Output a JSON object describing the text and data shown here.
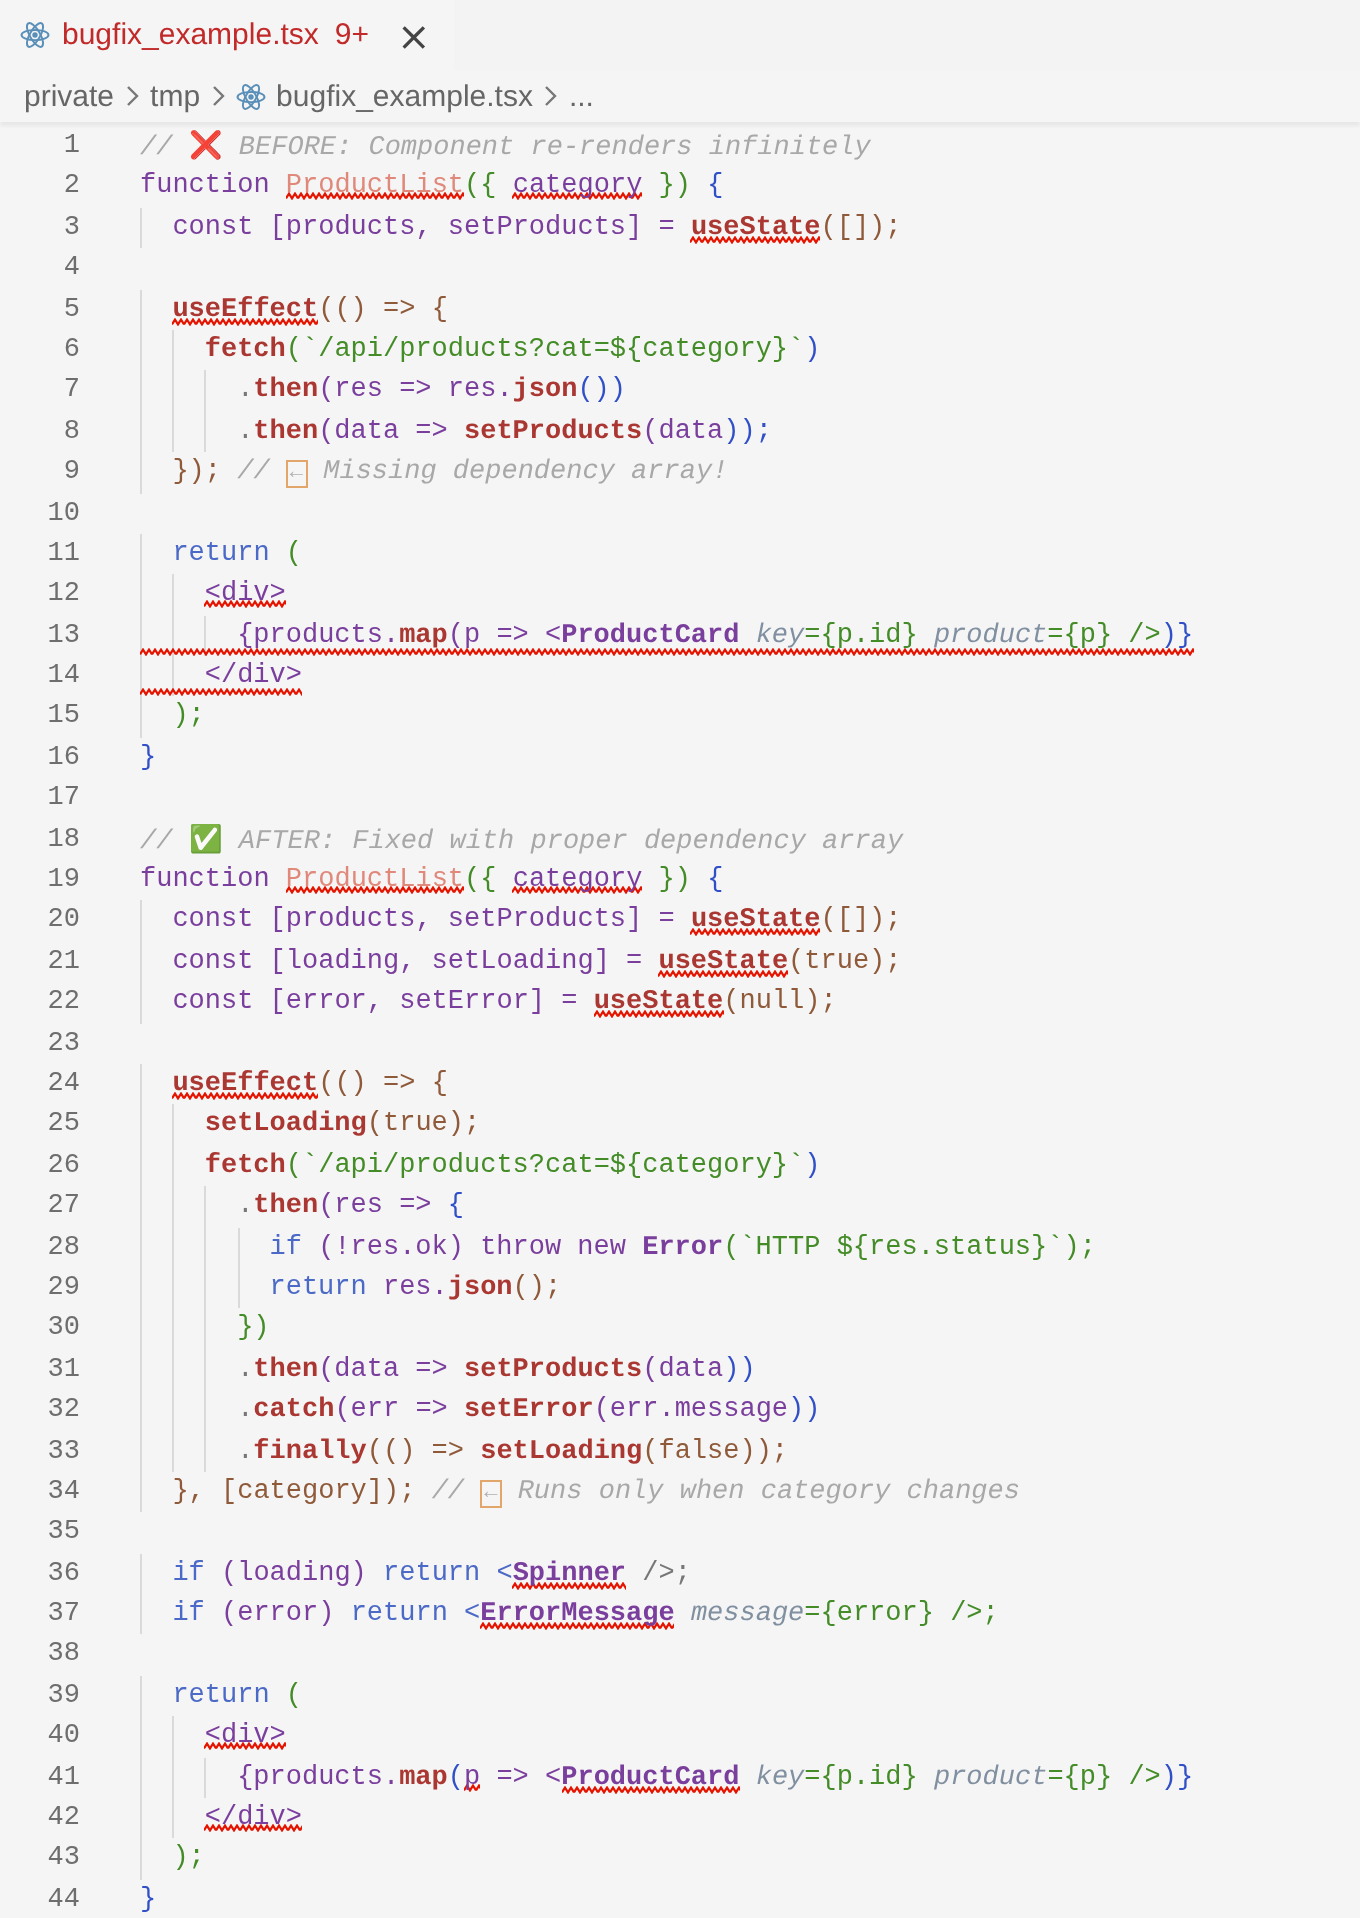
{
  "tab": {
    "title": "bugfix_example.tsx",
    "problems": "9+",
    "close": "×"
  },
  "breadcrumbs": [
    {
      "label": "private",
      "kind": "folder"
    },
    {
      "label": "tmp",
      "kind": "folder"
    },
    {
      "label": "bugfix_example.tsx",
      "kind": "file"
    },
    {
      "label": "...",
      "kind": "more"
    }
  ],
  "lines": [
    {
      "number": "1",
      "squiggly": false,
      "tokens": [
        {
          "kind": "cmt",
          "text": "// ",
          "squiggly": false
        },
        {
          "kind": "emoji",
          "text": "❌",
          "squiggly": false
        },
        {
          "kind": "cmt",
          "text": " BEFORE: Component re-renders infinitely",
          "squiggly": false
        }
      ]
    },
    {
      "number": "2",
      "squiggly": false,
      "tokens": [
        {
          "kind": "kw",
          "text": "function ",
          "squiggly": false
        },
        {
          "kind": "decl",
          "text": "ProductList",
          "squiggly": true
        },
        {
          "kind": "b2",
          "text": "({ ",
          "squiggly": false
        },
        {
          "kind": "var",
          "text": "category",
          "squiggly": true
        },
        {
          "kind": "b2",
          "text": " }) ",
          "squiggly": false
        },
        {
          "kind": "b3",
          "text": "{",
          "squiggly": false
        }
      ]
    },
    {
      "number": "3",
      "squiggly": false,
      "tokens": [
        {
          "kind": "kw",
          "text": "  const ",
          "squiggly": false
        },
        {
          "kind": "var",
          "text": "[products, setProducts] = ",
          "squiggly": false
        },
        {
          "kind": "call",
          "text": "useState",
          "squiggly": true
        },
        {
          "kind": "b1",
          "text": "([]);",
          "squiggly": false
        }
      ]
    },
    {
      "number": "4"
    },
    {
      "number": "5",
      "squiggly": false,
      "tokens": [
        {
          "kind": "call",
          "text": "  useEffect",
          "squiggly": true
        },
        {
          "kind": "b1",
          "text": "(() => {",
          "squiggly": false
        }
      ]
    },
    {
      "number": "6",
      "squiggly": false,
      "tokens": [
        {
          "kind": "call",
          "text": "    fetch",
          "squiggly": false
        },
        {
          "kind": "str",
          "text": "(`/api/products?cat=${category}`",
          "squiggly": false
        },
        {
          "kind": "b3",
          "text": ")",
          "squiggly": false
        }
      ]
    },
    {
      "number": "7",
      "squiggly": false,
      "tokens": [
        {
          "kind": "pn",
          "text": "      .",
          "squiggly": false
        },
        {
          "kind": "call",
          "text": "then",
          "squiggly": false
        },
        {
          "kind": "var",
          "text": "(res => res.",
          "squiggly": false
        },
        {
          "kind": "call",
          "text": "json",
          "squiggly": false
        },
        {
          "kind": "b3",
          "text": "())",
          "squiggly": false
        }
      ]
    },
    {
      "number": "8",
      "squiggly": false,
      "tokens": [
        {
          "kind": "pn",
          "text": "      .",
          "squiggly": false
        },
        {
          "kind": "call",
          "text": "then",
          "squiggly": false
        },
        {
          "kind": "var",
          "text": "(data => ",
          "squiggly": false
        },
        {
          "kind": "call",
          "text": "setProducts",
          "squiggly": false
        },
        {
          "kind": "var",
          "text": "(data",
          "squiggly": false
        },
        {
          "kind": "b3",
          "text": "));",
          "squiggly": false
        }
      ]
    },
    {
      "number": "9",
      "squiggly": false,
      "tokens": [
        {
          "kind": "b1",
          "text": "  });",
          "squiggly": false
        },
        {
          "kind": "cmt",
          "text": " // ",
          "squiggly": false
        },
        {
          "kind": "glyph",
          "text": "←",
          "squiggly": false
        },
        {
          "kind": "cmt",
          "text": " Missing dependency array!",
          "squiggly": false
        }
      ]
    },
    {
      "number": "10"
    },
    {
      "number": "11",
      "squiggly": false,
      "tokens": [
        {
          "kind": "ctl",
          "text": "  return ",
          "squiggly": false
        },
        {
          "kind": "b2",
          "text": "(",
          "squiggly": false
        }
      ]
    },
    {
      "number": "12",
      "squiggly": false,
      "tokens": [
        {
          "kind": "tag",
          "text": "    <div>",
          "squiggly": true
        }
      ]
    },
    {
      "number": "13",
      "squiggly": true,
      "tokens": [
        {
          "kind": "var",
          "text": "      {products.",
          "squiggly": false
        },
        {
          "kind": "call",
          "text": "map",
          "squiggly": false
        },
        {
          "kind": "var",
          "text": "(p => <",
          "squiggly": false
        },
        {
          "kind": "comp",
          "text": "ProductCard ",
          "squiggly": false
        },
        {
          "kind": "attr",
          "text": "key",
          "squiggly": false
        },
        {
          "kind": "b2",
          "text": "={p.id} ",
          "squiggly": false
        },
        {
          "kind": "attr",
          "text": "product",
          "squiggly": false
        },
        {
          "kind": "b2",
          "text": "={p} />",
          "squiggly": false
        },
        {
          "kind": "b3",
          "text": ")}",
          "squiggly": false
        }
      ]
    },
    {
      "number": "14",
      "squiggly": true,
      "tokens": [
        {
          "kind": "tag",
          "text": "    </div>",
          "squiggly": false
        }
      ]
    },
    {
      "number": "15",
      "squiggly": false,
      "tokens": [
        {
          "kind": "b2",
          "text": "  );",
          "squiggly": false
        }
      ]
    },
    {
      "number": "16",
      "squiggly": false,
      "tokens": [
        {
          "kind": "b3",
          "text": "}",
          "squiggly": false
        }
      ]
    },
    {
      "number": "17"
    },
    {
      "number": "18",
      "squiggly": false,
      "tokens": [
        {
          "kind": "cmt",
          "text": "// ",
          "squiggly": false
        },
        {
          "kind": "emoji",
          "text": "✅",
          "squiggly": false
        },
        {
          "kind": "cmt",
          "text": " AFTER: Fixed with proper dependency array",
          "squiggly": false
        }
      ]
    },
    {
      "number": "19",
      "squiggly": false,
      "tokens": [
        {
          "kind": "kw",
          "text": "function ",
          "squiggly": false
        },
        {
          "kind": "decl",
          "text": "ProductList",
          "squiggly": true
        },
        {
          "kind": "b2",
          "text": "({ ",
          "squiggly": false
        },
        {
          "kind": "var",
          "text": "category",
          "squiggly": true
        },
        {
          "kind": "b2",
          "text": " }) ",
          "squiggly": false
        },
        {
          "kind": "b3",
          "text": "{",
          "squiggly": false
        }
      ]
    },
    {
      "number": "20",
      "squiggly": false,
      "tokens": [
        {
          "kind": "kw",
          "text": "  const ",
          "squiggly": false
        },
        {
          "kind": "var",
          "text": "[products, setProducts] = ",
          "squiggly": false
        },
        {
          "kind": "call",
          "text": "useState",
          "squiggly": true
        },
        {
          "kind": "b1",
          "text": "([]);",
          "squiggly": false
        }
      ]
    },
    {
      "number": "21",
      "squiggly": false,
      "tokens": [
        {
          "kind": "kw",
          "text": "  const ",
          "squiggly": false
        },
        {
          "kind": "var",
          "text": "[loading, setLoading] = ",
          "squiggly": false
        },
        {
          "kind": "call",
          "text": "useState",
          "squiggly": true
        },
        {
          "kind": "b1",
          "text": "(true);",
          "squiggly": false
        }
      ]
    },
    {
      "number": "22",
      "squiggly": false,
      "tokens": [
        {
          "kind": "kw",
          "text": "  const ",
          "squiggly": false
        },
        {
          "kind": "var",
          "text": "[error, setError] = ",
          "squiggly": false
        },
        {
          "kind": "call",
          "text": "useState",
          "squiggly": true
        },
        {
          "kind": "b1",
          "text": "(null);",
          "squiggly": false
        }
      ]
    },
    {
      "number": "23"
    },
    {
      "number": "24",
      "squiggly": false,
      "tokens": [
        {
          "kind": "call",
          "text": "  useEffect",
          "squiggly": true
        },
        {
          "kind": "b1",
          "text": "(() => {",
          "squiggly": false
        }
      ]
    },
    {
      "number": "25",
      "squiggly": false,
      "tokens": [
        {
          "kind": "call",
          "text": "    setLoading",
          "squiggly": false
        },
        {
          "kind": "b1",
          "text": "(true);",
          "squiggly": false
        }
      ]
    },
    {
      "number": "26",
      "squiggly": false,
      "tokens": [
        {
          "kind": "call",
          "text": "    fetch",
          "squiggly": false
        },
        {
          "kind": "str",
          "text": "(`/api/products?cat=${category}`",
          "squiggly": false
        },
        {
          "kind": "b3",
          "text": ")",
          "squiggly": false
        }
      ]
    },
    {
      "number": "27",
      "squiggly": false,
      "tokens": [
        {
          "kind": "pn",
          "text": "      .",
          "squiggly": false
        },
        {
          "kind": "call",
          "text": "then",
          "squiggly": false
        },
        {
          "kind": "var",
          "text": "(res => ",
          "squiggly": false
        },
        {
          "kind": "b3",
          "text": "{",
          "squiggly": false
        }
      ]
    },
    {
      "number": "28",
      "squiggly": false,
      "tokens": [
        {
          "kind": "ctl",
          "text": "        if ",
          "squiggly": false
        },
        {
          "kind": "var",
          "text": "(!res.ok) ",
          "squiggly": false
        },
        {
          "kind": "kw",
          "text": "throw new ",
          "squiggly": false
        },
        {
          "kind": "comp",
          "text": "Error",
          "squiggly": false
        },
        {
          "kind": "str",
          "text": "(`HTTP ${res.status}`);",
          "squiggly": false
        }
      ]
    },
    {
      "number": "29",
      "squiggly": false,
      "tokens": [
        {
          "kind": "ctl",
          "text": "        return ",
          "squiggly": false
        },
        {
          "kind": "var",
          "text": "res.",
          "squiggly": false
        },
        {
          "kind": "call",
          "text": "json",
          "squiggly": false
        },
        {
          "kind": "b1",
          "text": "();",
          "squiggly": false
        }
      ]
    },
    {
      "number": "30",
      "squiggly": false,
      "tokens": [
        {
          "kind": "b2",
          "text": "      })",
          "squiggly": false
        }
      ]
    },
    {
      "number": "31",
      "squiggly": false,
      "tokens": [
        {
          "kind": "pn",
          "text": "      .",
          "squiggly": false
        },
        {
          "kind": "call",
          "text": "then",
          "squiggly": false
        },
        {
          "kind": "var",
          "text": "(data => ",
          "squiggly": false
        },
        {
          "kind": "call",
          "text": "setProducts",
          "squiggly": false
        },
        {
          "kind": "var",
          "text": "(data",
          "squiggly": false
        },
        {
          "kind": "b3",
          "text": "))",
          "squiggly": false
        }
      ]
    },
    {
      "number": "32",
      "squiggly": false,
      "tokens": [
        {
          "kind": "pn",
          "text": "      .",
          "squiggly": false
        },
        {
          "kind": "call",
          "text": "catch",
          "squiggly": false
        },
        {
          "kind": "var",
          "text": "(err => ",
          "squiggly": false
        },
        {
          "kind": "call",
          "text": "setError",
          "squiggly": false
        },
        {
          "kind": "var",
          "text": "(err.message",
          "squiggly": false
        },
        {
          "kind": "b3",
          "text": "))",
          "squiggly": false
        }
      ]
    },
    {
      "number": "33",
      "squiggly": false,
      "tokens": [
        {
          "kind": "pn",
          "text": "      .",
          "squiggly": false
        },
        {
          "kind": "call",
          "text": "finally",
          "squiggly": false
        },
        {
          "kind": "b1",
          "text": "(() => ",
          "squiggly": false
        },
        {
          "kind": "call",
          "text": "setLoading",
          "squiggly": false
        },
        {
          "kind": "b1",
          "text": "(false));",
          "squiggly": false
        }
      ]
    },
    {
      "number": "34",
      "squiggly": false,
      "tokens": [
        {
          "kind": "b1",
          "text": "  }, [category]);",
          "squiggly": false
        },
        {
          "kind": "cmt",
          "text": " // ",
          "squiggly": false
        },
        {
          "kind": "glyph",
          "text": "←",
          "squiggly": false
        },
        {
          "kind": "cmt",
          "text": " Runs only when category changes",
          "squiggly": false
        }
      ]
    },
    {
      "number": "35"
    },
    {
      "number": "36",
      "squiggly": false,
      "tokens": [
        {
          "kind": "ctl",
          "text": "  if ",
          "squiggly": false
        },
        {
          "kind": "var",
          "text": "(loading) ",
          "squiggly": false
        },
        {
          "kind": "ctl",
          "text": "return <",
          "squiggly": false
        },
        {
          "kind": "comp",
          "text": "Spinner",
          "squiggly": true
        },
        {
          "kind": "pn",
          "text": " />;",
          "squiggly": false
        }
      ]
    },
    {
      "number": "37",
      "squiggly": false,
      "tokens": [
        {
          "kind": "ctl",
          "text": "  if ",
          "squiggly": false
        },
        {
          "kind": "var",
          "text": "(error) ",
          "squiggly": false
        },
        {
          "kind": "ctl",
          "text": "return <",
          "squiggly": false
        },
        {
          "kind": "comp",
          "text": "ErrorMessage",
          "squiggly": true
        },
        {
          "kind": "attr",
          "text": " message",
          "squiggly": false
        },
        {
          "kind": "b2",
          "text": "={error} />;",
          "squiggly": false
        }
      ]
    },
    {
      "number": "38"
    },
    {
      "number": "39",
      "squiggly": false,
      "tokens": [
        {
          "kind": "ctl",
          "text": "  return ",
          "squiggly": false
        },
        {
          "kind": "b2",
          "text": "(",
          "squiggly": false
        }
      ]
    },
    {
      "number": "40",
      "squiggly": false,
      "tokens": [
        {
          "kind": "tag",
          "text": "    <div>",
          "squiggly": true
        }
      ]
    },
    {
      "number": "41",
      "squiggly": false,
      "tokens": [
        {
          "kind": "var",
          "text": "      {products.",
          "squiggly": false
        },
        {
          "kind": "call",
          "text": "map",
          "squiggly": false
        },
        {
          "kind": "b3",
          "text": "(",
          "squiggly": false
        },
        {
          "kind": "var",
          "text": "p",
          "squiggly": true
        },
        {
          "kind": "var",
          "text": " => <",
          "squiggly": false
        },
        {
          "kind": "comp",
          "text": "ProductCard",
          "squiggly": true
        },
        {
          "kind": "attr",
          "text": " key",
          "squiggly": false
        },
        {
          "kind": "b2",
          "text": "={p.id} ",
          "squiggly": false
        },
        {
          "kind": "attr",
          "text": "product",
          "squiggly": false
        },
        {
          "kind": "b2",
          "text": "={p} />",
          "squiggly": false
        },
        {
          "kind": "b3",
          "text": ")}",
          "squiggly": false
        }
      ]
    },
    {
      "number": "42",
      "squiggly": false,
      "tokens": [
        {
          "kind": "tag",
          "text": "    </div>",
          "squiggly": true
        }
      ]
    },
    {
      "number": "43",
      "squiggly": false,
      "tokens": [
        {
          "kind": "b2",
          "text": "  );",
          "squiggly": false
        }
      ]
    },
    {
      "number": "44",
      "squiggly": false,
      "tokens": [
        {
          "kind": "b3",
          "text": "}",
          "squiggly": false
        }
      ]
    }
  ]
}
